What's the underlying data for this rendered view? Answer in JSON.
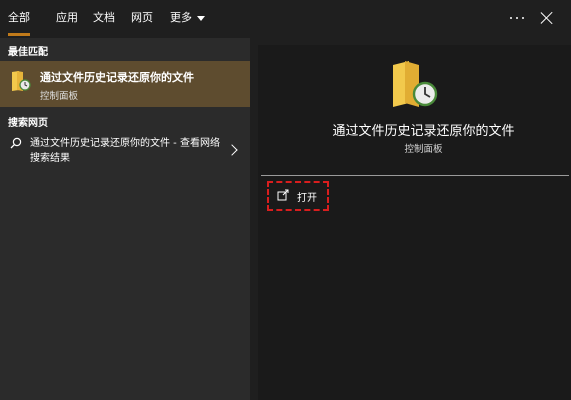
{
  "tabs": [
    {
      "label": "全部",
      "active": true
    },
    {
      "label": "应用",
      "active": false
    },
    {
      "label": "文档",
      "active": false
    },
    {
      "label": "网页",
      "active": false
    },
    {
      "label": "更多",
      "active": false
    }
  ],
  "best_match": {
    "header": "最佳匹配",
    "title": "通过文件历史记录还原你的文件",
    "subtitle": "控制面板",
    "icon": "folder-clock-icon"
  },
  "web_search": {
    "header": "搜索网页",
    "text": "通过文件历史记录还原你的文件 - 查看网络搜索结果",
    "icon": "search-icon"
  },
  "preview": {
    "title": "通过文件历史记录还原你的文件",
    "subtitle": "控制面板",
    "open_label": "打开"
  },
  "colors": {
    "accent": "#c07a1a",
    "selected_bg": "#5e4c2f",
    "highlight_border": "#d81e1e"
  }
}
